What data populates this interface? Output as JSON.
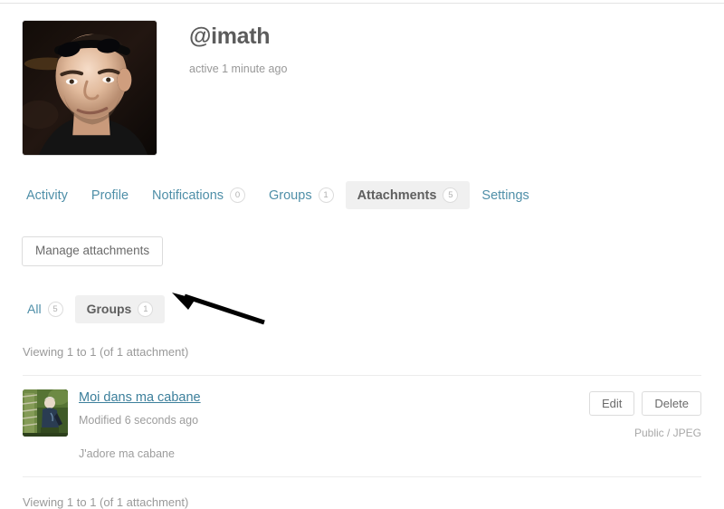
{
  "profile": {
    "avatar_alt": "user-avatar-photo",
    "username": "@imath",
    "activity_status": "active 1 minute ago"
  },
  "nav": {
    "items": [
      {
        "label": "Activity",
        "count": null,
        "active": false
      },
      {
        "label": "Profile",
        "count": null,
        "active": false
      },
      {
        "label": "Notifications",
        "count": "0",
        "active": false
      },
      {
        "label": "Groups",
        "count": "1",
        "active": false
      },
      {
        "label": "Attachments",
        "count": "5",
        "active": true
      },
      {
        "label": "Settings",
        "count": null,
        "active": false
      }
    ]
  },
  "toolbar": {
    "manage_label": "Manage attachments"
  },
  "subnav": {
    "items": [
      {
        "label": "All",
        "count": "5",
        "active": false
      },
      {
        "label": "Groups",
        "count": "1",
        "active": true
      }
    ]
  },
  "annotation": {
    "arrow": "left-pointing-arrow"
  },
  "list": {
    "viewing_top": "Viewing 1 to 1 (of 1 attachment)",
    "viewing_bottom": "Viewing 1 to 1 (of 1 attachment)",
    "rows": [
      {
        "thumb_alt": "attachment-thumbnail-photo",
        "title": "Moi dans ma cabane",
        "modified": "Modified 6 seconds ago",
        "description": "J'adore ma cabane",
        "edit_label": "Edit",
        "delete_label": "Delete",
        "meta": "Public / JPEG"
      }
    ]
  },
  "colors": {
    "link": "#4f8fa8",
    "active_tab_bg": "#f0f0f0",
    "muted_text": "#9a9a9a",
    "border": "#dcdcdc"
  }
}
